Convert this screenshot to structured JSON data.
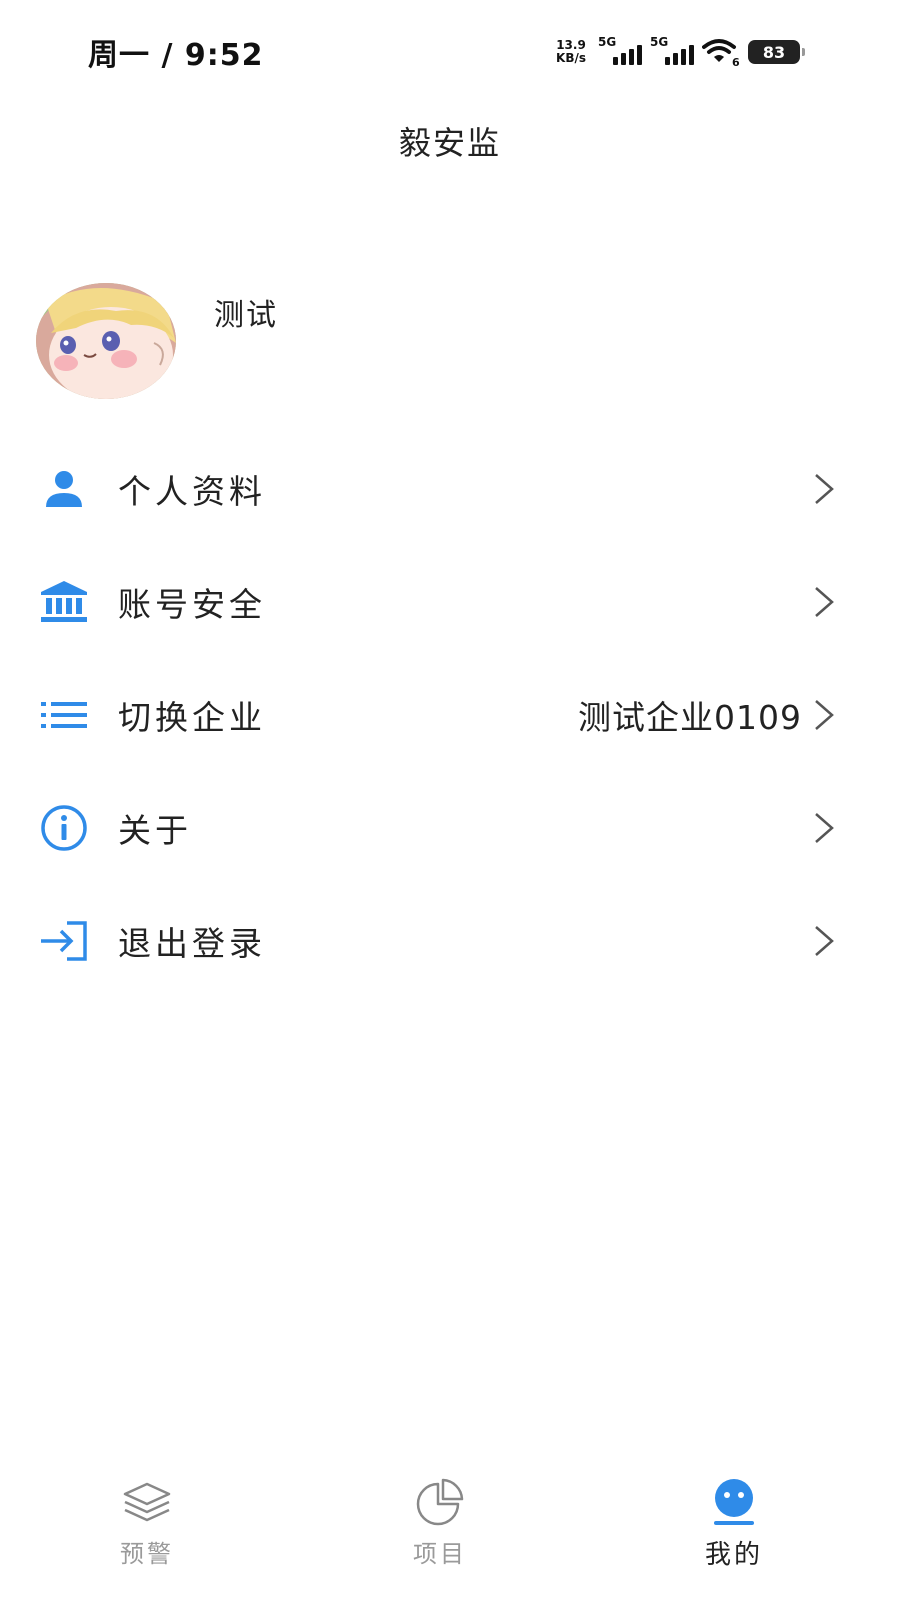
{
  "status_bar": {
    "time": "周一 / 9:52",
    "net_speed_value": "13.9",
    "net_speed_unit": "KB/s",
    "sim1": "5G",
    "sim2": "5G",
    "wifi_badge": "6",
    "battery": "83"
  },
  "header": {
    "title": "毅安监"
  },
  "profile": {
    "name": "测试",
    "avatar_icon": "cartoon-avatar-icon"
  },
  "menu": {
    "items": [
      {
        "label": "个人资料",
        "value": "",
        "icon": "person-icon"
      },
      {
        "label": "账号安全",
        "value": "",
        "icon": "bank-icon"
      },
      {
        "label": "切换企业",
        "value": "测试企业0109",
        "icon": "list-icon"
      },
      {
        "label": "关于",
        "value": "",
        "icon": "info-icon"
      },
      {
        "label": "退出登录",
        "value": "",
        "icon": "logout-icon"
      }
    ]
  },
  "tab_bar": {
    "tabs": [
      {
        "label": "预警",
        "icon": "layers-icon",
        "active": false
      },
      {
        "label": "项目",
        "icon": "pie-chart-icon",
        "active": false
      },
      {
        "label": "我的",
        "icon": "profile-face-icon",
        "active": true
      }
    ]
  },
  "colors": {
    "accent": "#2f8be8",
    "text": "#222222",
    "inactive": "#9a9a9a"
  }
}
